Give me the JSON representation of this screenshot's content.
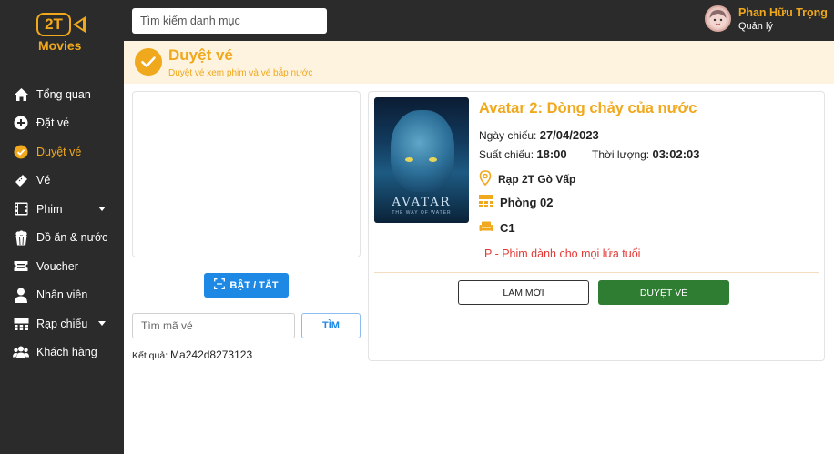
{
  "app": {
    "logo_text": "2T",
    "logo_sub": "Movies"
  },
  "sidebar": {
    "items": [
      {
        "label": "Tổng quan",
        "icon": "home-icon",
        "active": false
      },
      {
        "label": "Đặt vé",
        "icon": "plus-circle-icon",
        "active": false
      },
      {
        "label": "Duyệt vé",
        "icon": "check-circle-icon",
        "active": true
      },
      {
        "label": "Vé",
        "icon": "ticket-icon",
        "active": false
      },
      {
        "label": "Phim",
        "icon": "film-icon",
        "active": false,
        "has_dropdown": true
      },
      {
        "label": "Đồ ăn & nước",
        "icon": "popcorn-icon",
        "active": false
      },
      {
        "label": "Voucher",
        "icon": "voucher-icon",
        "active": false
      },
      {
        "label": "Nhân viên",
        "icon": "user-icon",
        "active": false
      },
      {
        "label": "Rạp chiếu",
        "icon": "cinema-icon",
        "active": false,
        "has_dropdown": true
      },
      {
        "label": "Khách hàng",
        "icon": "users-icon",
        "active": false
      }
    ]
  },
  "topbar": {
    "search_placeholder": "Tìm kiếm danh mục",
    "user_name": "Phan Hữu Trọng",
    "user_role": "Quản lý"
  },
  "page": {
    "title": "Duyệt vé",
    "subtitle": "Duyệt vé xem phim và vé bắp nước"
  },
  "scanner": {
    "toggle_label": "BẬT / TẮT",
    "input_placeholder": "Tìm mã vé",
    "find_label": "TÌM",
    "result_label": "Kết quả:",
    "result_value": "Ma242d8273123"
  },
  "ticket": {
    "poster_title": "AVATAR",
    "poster_tagline": "THE WAY OF WATER",
    "movie_title": "Avatar 2: Dòng chảy của nước",
    "date_label": "Ngày chiếu:",
    "date_value": "27/04/2023",
    "show_label": "Suất chiếu:",
    "show_value": "18:00",
    "duration_label": "Thời lượng:",
    "duration_value": "03:02:03",
    "cinema": "Rạp 2T Gò Vấp",
    "room": "Phòng 02",
    "seat": "C1",
    "rating": "P - Phim dành cho mọi lứa tuổi",
    "reset_label": "LÀM MỚI",
    "approve_label": "DUYỆT VÉ"
  },
  "colors": {
    "accent": "#f0a81c",
    "sidebar_bg": "#2b2b2b",
    "primary_blue": "#1e88e5",
    "approve_green": "#2e7d32",
    "rating_red": "#e53935"
  }
}
